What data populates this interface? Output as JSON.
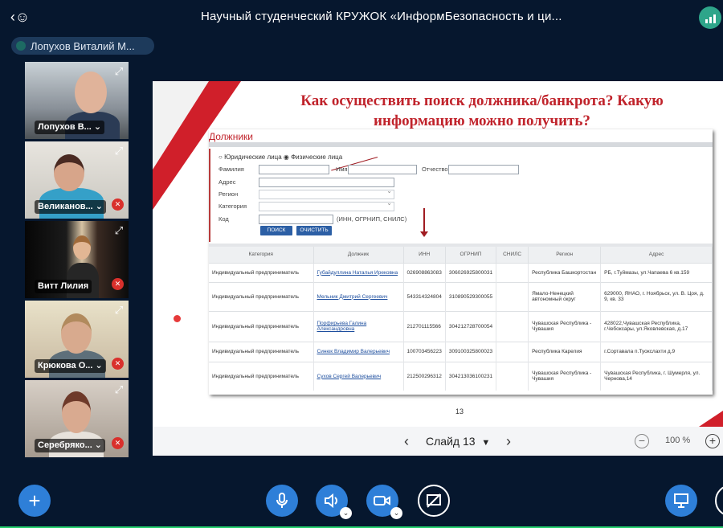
{
  "header": {
    "title": "Научный студенческий КРУЖОК «ИнформБезопасность и ци...",
    "users_icon": "users-icon",
    "connection_icon": "connection-status-icon"
  },
  "presenter": {
    "name": "Лопухов Виталий М..."
  },
  "participants": [
    {
      "name": "Лопухов В...",
      "muted": false
    },
    {
      "name": "Великанов...",
      "muted": true
    },
    {
      "name": "Витт Лилия",
      "muted": true
    },
    {
      "name": "Крюкова О...",
      "muted": true
    },
    {
      "name": "Серебряко...",
      "muted": true
    }
  ],
  "slide": {
    "title_line1": "Как осуществить поиск должника/банкрота? Какую",
    "title_line2": "информацию можно получить?",
    "number": "13",
    "screenshot": {
      "heading": "Должники",
      "radio_legal": "Юридические лица",
      "radio_physical": "Физические лица",
      "label_surname": "Фамилия",
      "label_name": "Имя",
      "label_patronymic": "Отчество",
      "label_address": "Адрес",
      "label_region": "Регион",
      "label_category": "Категория",
      "label_code": "Код",
      "code_hint": "(ИНН, ОГРНИП, СНИЛС)",
      "search_button": "ПОИСК",
      "clear_button": "ОЧИСТИТЬ",
      "columns": [
        "Категория",
        "Должник",
        "ИНН",
        "ОГРНИП",
        "СНИЛС",
        "Регион",
        "Адрес"
      ],
      "rows": [
        [
          "Индивидуальный предприниматель",
          "Губайдуллина Наталья Ирековна",
          "026908863083",
          "306026925800031",
          "",
          "Республика Башкортостан",
          "РБ, г.Туймазы, ул.Чапаева 6 кв.159"
        ],
        [
          "Индивидуальный предприниматель",
          "Мельник Дмитрий Сергеевич",
          "543314324804",
          "310890529300055",
          "",
          "Ямало-Ненецкий автономный округ",
          "629000, ЯНАО, г. Ноябрьск, ул. В. Цоя, д. 9, кв. 33"
        ],
        [
          "Индивидуальный предприниматель",
          "Порфирьева Галина Александровна",
          "212701115566",
          "304212728700054",
          "",
          "Чувашская Республика - Чувашия",
          "428022,Чувашская Республика, г.Чебоксары, ул.Яковлевская, д.17"
        ],
        [
          "Индивидуальный предприниматель",
          "Синюк Владимир Валерьевич",
          "100703456223",
          "309100325800023",
          "",
          "Республика Карелия",
          "г.Сортавала п.Туокслахти д.9"
        ],
        [
          "Индивидуальный предприниматель",
          "Сухов Сергей Валерьевич",
          "212500296312",
          "304213036100231",
          "",
          "Чувашская Республика - Чувашия",
          "Чувашская Республика, г. Шумерля, ул. Чернова,14"
        ]
      ]
    }
  },
  "slide_nav": {
    "label": "Слайд 13",
    "zoom": "100 %"
  },
  "colors": {
    "accent": "#2e7fd8",
    "background": "#06172e",
    "slide_red": "#c0232b"
  }
}
